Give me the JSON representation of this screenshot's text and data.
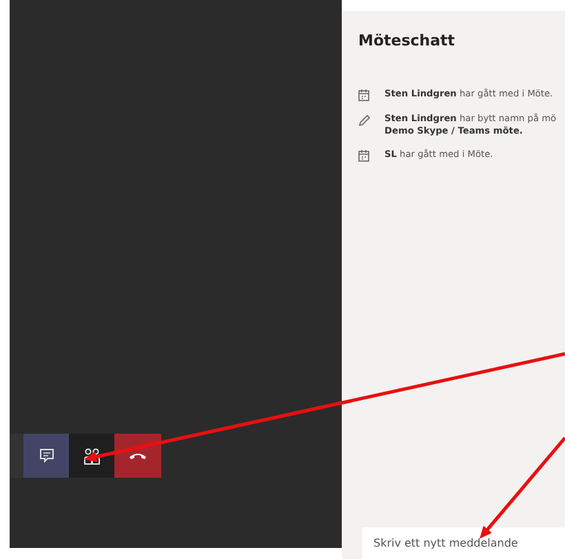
{
  "call_controls": [
    {
      "kind": "segment",
      "selected": false
    },
    {
      "kind": "chat",
      "selected": true
    },
    {
      "kind": "people",
      "selected": false
    },
    {
      "kind": "hangup",
      "selected": false
    }
  ],
  "chat": {
    "title": "Möteschatt",
    "messages": [
      {
        "kind": "joined",
        "lines": [
          "**Sten Lindgren** har gått med i Möte."
        ]
      },
      {
        "kind": "renamed",
        "lines": [
          "**Sten Lindgren** har bytt namn på mö",
          "**Demo Skype / Teams möte.**"
        ]
      },
      {
        "kind": "joined",
        "lines": [
          "**SL** har gått med i Möte."
        ]
      }
    ],
    "compose": {
      "placeholder": "Skriv ett nytt meddelande"
    }
  }
}
